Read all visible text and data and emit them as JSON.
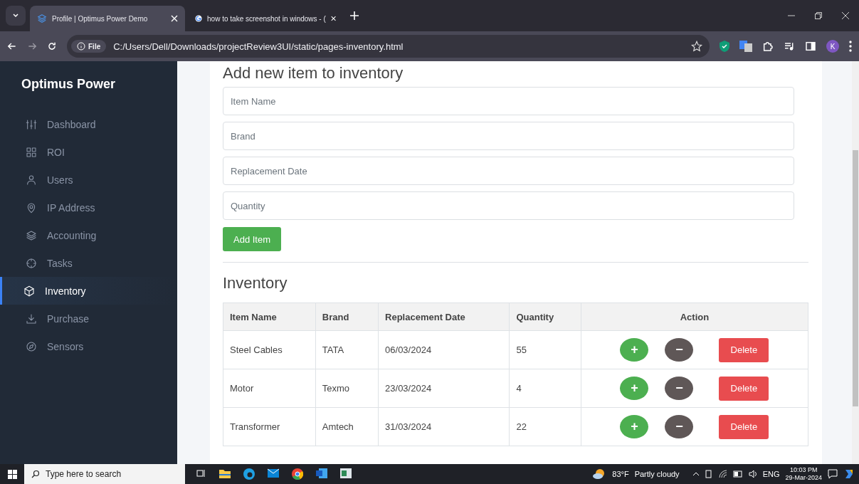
{
  "browser": {
    "tabs": [
      {
        "title": "Profile | Optimus Power Demo",
        "selected": true
      },
      {
        "title": "how to take screenshot in windows - (",
        "selected": false
      }
    ],
    "address": {
      "scheme": "File",
      "url": "C:/Users/Dell/Downloads/projectReview3UI/static/pages-inventory.html"
    },
    "profile": "K"
  },
  "sidebar": {
    "brand": "Optimus Power",
    "items": [
      {
        "label": "Dashboard",
        "selected": false
      },
      {
        "label": "ROI",
        "selected": false
      },
      {
        "label": "Users",
        "selected": false
      },
      {
        "label": "IP Address",
        "selected": false
      },
      {
        "label": "Accounting",
        "selected": false
      },
      {
        "label": "Tasks",
        "selected": false
      },
      {
        "label": "Inventory",
        "selected": true
      },
      {
        "label": "Purchase",
        "selected": false
      },
      {
        "label": "Sensors",
        "selected": false
      }
    ]
  },
  "form": {
    "title": "Add new item to inventory",
    "fields": [
      {
        "placeholder": "Item Name"
      },
      {
        "placeholder": "Brand"
      },
      {
        "placeholder": "Replacement Date"
      },
      {
        "placeholder": "Quantity"
      }
    ],
    "submit": "Add Item"
  },
  "inventory": {
    "title": "Inventory",
    "columns": [
      "Item Name",
      "Brand",
      "Replacement Date",
      "Quantity",
      "Action"
    ],
    "rows": [
      {
        "cells": [
          "Steel Cables",
          "TATA",
          "06/03/2024",
          "55"
        ],
        "increase": "+",
        "decrease": "−",
        "delete": "Delete"
      },
      {
        "cells": [
          "Motor",
          "Texmo",
          "23/03/2024",
          "4"
        ],
        "increase": "+",
        "decrease": "−",
        "delete": "Delete"
      },
      {
        "cells": [
          "Transformer",
          "Amtech",
          "31/03/2024",
          "22"
        ],
        "increase": "+",
        "decrease": "−",
        "delete": "Delete"
      }
    ]
  },
  "taskbar": {
    "search_placeholder": "Type here to search",
    "temperature": "83°F",
    "weather": "Partly cloudy",
    "language": "ENG",
    "time": "10:03 PM",
    "date": "29-Mar-2024"
  }
}
